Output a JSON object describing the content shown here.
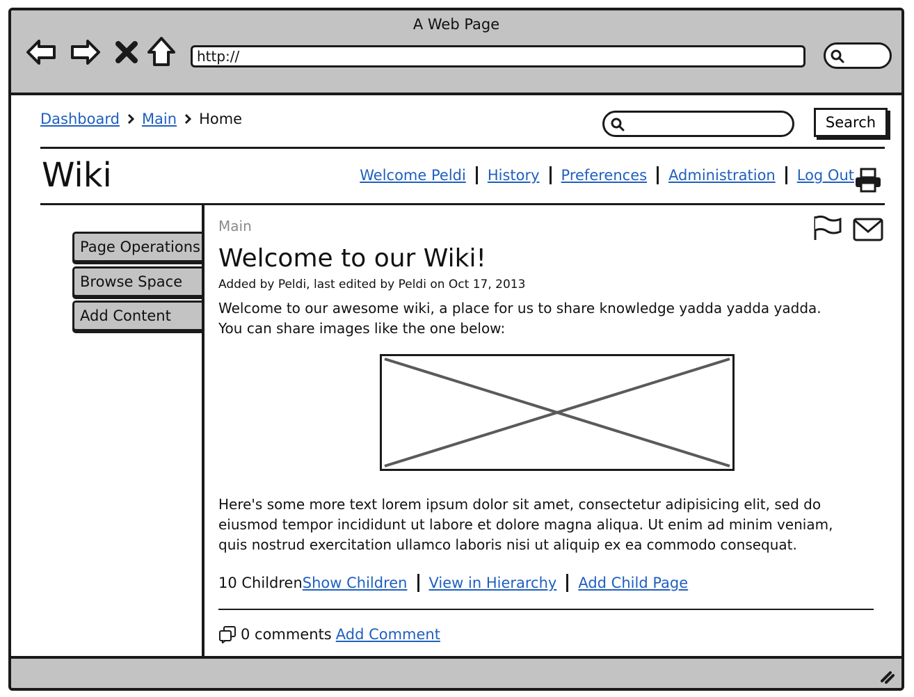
{
  "browser": {
    "title": "A Web Page",
    "url": "http://",
    "nav_icons": [
      "back-arrow-icon",
      "forward-arrow-icon",
      "stop-icon",
      "home-icon"
    ]
  },
  "breadcrumb": {
    "items": [
      "Dashboard",
      "Main"
    ],
    "current": "Home"
  },
  "search": {
    "placeholder": "",
    "button_label": "Search"
  },
  "site": {
    "title": "Wiki"
  },
  "user_links": [
    "Welcome Peldi",
    "History",
    "Preferences",
    "Administration",
    "Log Out"
  ],
  "sidebar": {
    "items": [
      "Page Operations",
      "Browse Space",
      "Add Content"
    ]
  },
  "page": {
    "space": "Main",
    "title": "Welcome to our Wiki!",
    "byline": "Added by Peldi, last edited by Peldi on Oct 17, 2013",
    "intro_line1": "Welcome to our awesome wiki, a place for us to share knowledge yadda yadda yadda.",
    "intro_line2": "You can share images like the one below:",
    "body_line1": "Here's some more text lorem ipsum dolor sit amet, consectetur adipisicing elit, sed do",
    "body_line2": "eiusmod tempor incididunt ut labore et dolore magna aliqua. Ut enim ad minim veniam,",
    "body_line3": "quis nostrud exercitation ullamco laboris nisi ut aliquip ex ea commodo consequat."
  },
  "children": {
    "count_label": "10 Children",
    "links": [
      "Show Children",
      "View in Hierarchy",
      "Add Child Page"
    ]
  },
  "comments": {
    "count_label": "0 comments",
    "add_label": "Add Comment"
  },
  "colors": {
    "chrome": "#c3c3c3",
    "link": "#1f5fbf",
    "border": "#1a1a1a",
    "muted": "#8a8a8a"
  }
}
